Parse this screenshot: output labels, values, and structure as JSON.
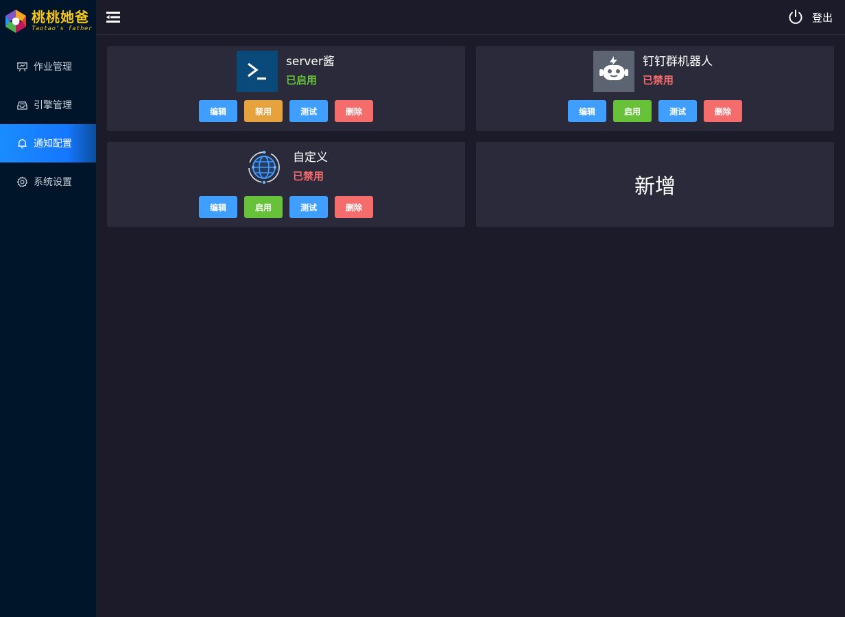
{
  "brand": {
    "title": "桃桃她爸",
    "subtitle": "Taotao's father"
  },
  "sidebar": {
    "items": [
      {
        "label": "作业管理",
        "icon": "presentation-board-icon",
        "active": false
      },
      {
        "label": "引擎管理",
        "icon": "inbox-tray-icon",
        "active": false
      },
      {
        "label": "通知配置",
        "icon": "bell-icon",
        "active": true
      },
      {
        "label": "系统设置",
        "icon": "gear-icon",
        "active": false
      }
    ]
  },
  "header": {
    "logout_label": "登出"
  },
  "buttons": {
    "edit": "编辑",
    "disable": "禁用",
    "enable": "启用",
    "test": "测试",
    "delete": "删除"
  },
  "cards": [
    {
      "name": "server酱",
      "status": "已启用",
      "enabled": true,
      "icon": "terminal-icon"
    },
    {
      "name": "钉钉群机器人",
      "status": "已禁用",
      "enabled": false,
      "icon": "robot-icon"
    },
    {
      "name": "自定义",
      "status": "已禁用",
      "enabled": false,
      "icon": "globe-icon"
    }
  ],
  "add_card": {
    "label": "新增"
  },
  "colors": {
    "sidebar_bg": "#001529",
    "main_bg": "#1b1b29",
    "card_bg": "#2a2a3a",
    "active_menu": "#1677ff",
    "btn_blue": "#409eff",
    "btn_orange": "#e6a23c",
    "btn_green": "#67c23a",
    "btn_red": "#f56c6c",
    "brand_yellow": "#f5c518"
  }
}
